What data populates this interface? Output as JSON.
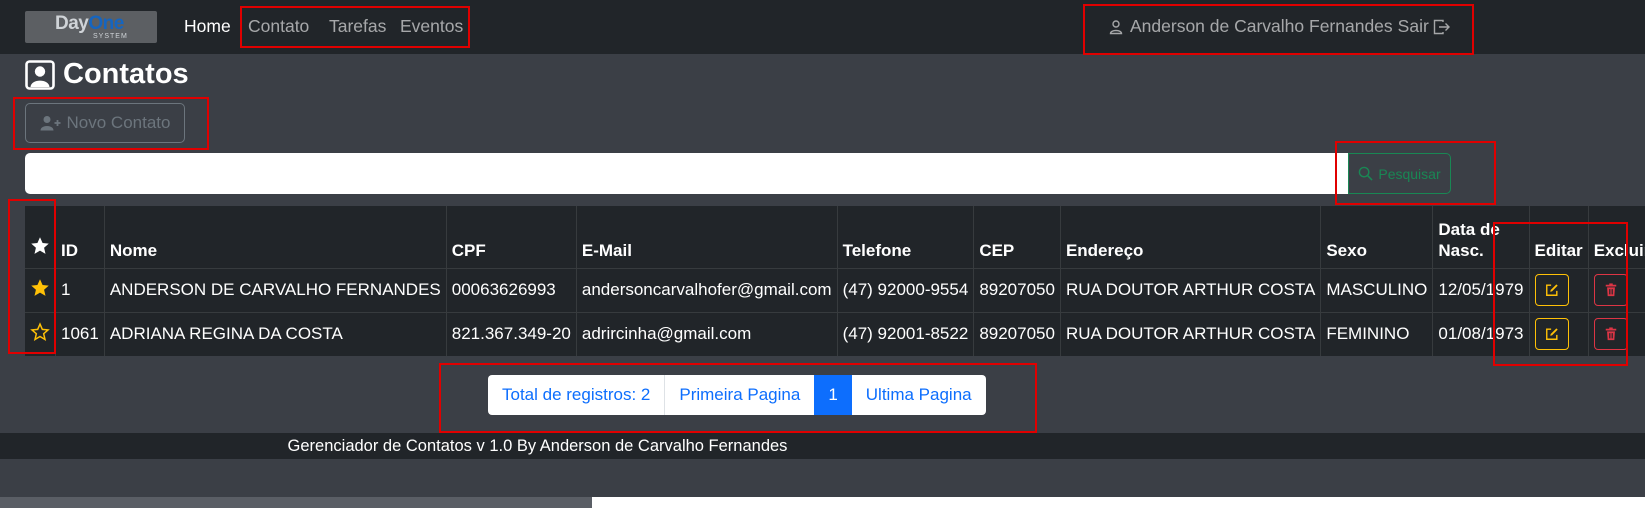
{
  "nav": {
    "logo_day": "Day",
    "logo_one": "One",
    "logo_sub": "SYSTEM",
    "home": "Home",
    "contato": "Contato",
    "tarefas": "Tarefas",
    "eventos": "Eventos",
    "user": "Anderson de Carvalho Fernandes",
    "sair": "Sair"
  },
  "page": {
    "title": "Contatos",
    "novo_contato": "Novo Contato",
    "search_value": "",
    "pesquisar": "Pesquisar"
  },
  "table": {
    "headers": {
      "id": "ID",
      "nome": "Nome",
      "cpf": "CPF",
      "email": "E-Mail",
      "telefone": "Telefone",
      "cep": "CEP",
      "endereco": "Endereço",
      "sexo": "Sexo",
      "nasc_line1": "Data de",
      "nasc_line2": "Nasc.",
      "editar": "Editar",
      "excluir": "Excluir"
    },
    "rows": [
      {
        "favorite": true,
        "id": "1",
        "nome": "ANDERSON DE CARVALHO FERNANDES",
        "cpf": "00063626993",
        "email": "andersoncarvalhofer@gmail.com",
        "telefone": "(47) 92000-9554",
        "cep": "89207050",
        "endereco": "RUA DOUTOR ARTHUR COSTA",
        "sexo": "MASCULINO",
        "nasc": "12/05/1979"
      },
      {
        "favorite": false,
        "id": "1061",
        "nome": "ADRIANA REGINA DA COSTA",
        "cpf": "821.367.349-20",
        "email": "adrircinha@gmail.com",
        "telefone": "(47) 92001-8522",
        "cep": "89207050",
        "endereco": "RUA DOUTOR ARTHUR COSTA",
        "sexo": "FEMININO",
        "nasc": "01/08/1973"
      }
    ]
  },
  "pagination": {
    "total": "Total de registros: 2",
    "first": "Primeira Pagina",
    "current": "1",
    "last": "Ultima Pagina"
  },
  "footer": {
    "text": "Gerenciador de Contatos v 1.0 By Anderson de Carvalho Fernandes"
  },
  "colors": {
    "navbar": "#212529",
    "page_bg": "#3b3f46",
    "highlight_box": "#e00000",
    "star": "#ffc107",
    "edit": "#ffc107",
    "delete": "#dc3545",
    "search": "#198754",
    "pagination_active": "#0d6efd"
  },
  "icons": {
    "user": "person-icon",
    "logout": "box-arrow-right-icon",
    "title": "person-square-icon",
    "add_user": "person-plus-icon",
    "search": "magnifier-icon",
    "favorite_on": "star-fill-icon",
    "favorite_off": "star-outline-icon",
    "edit": "pencil-square-icon",
    "delete": "trash-icon"
  }
}
